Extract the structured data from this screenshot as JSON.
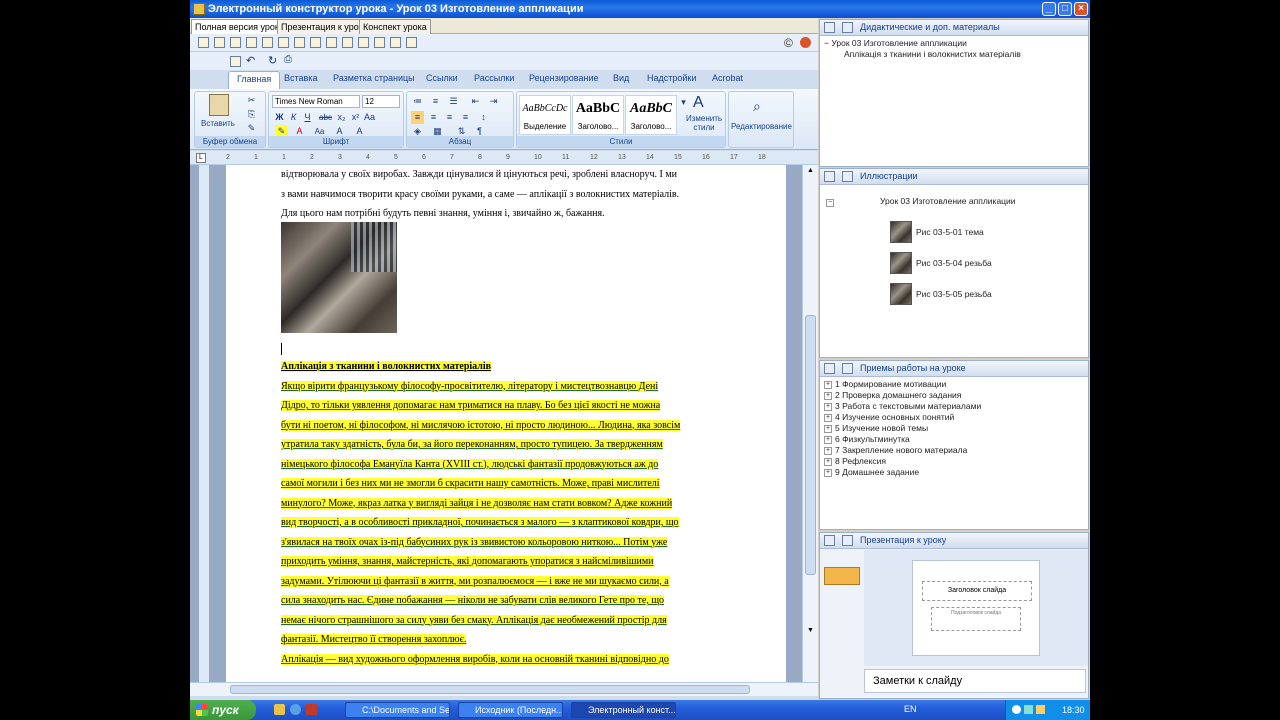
{
  "window": {
    "title": "Электронный конструктор урока - Урок 03 Изготовление аппликации",
    "controls": [
      "_",
      "□",
      "×"
    ]
  },
  "doc_tabs": [
    "Полная версия урока",
    "Презентация к уроку",
    "Конспект урока"
  ],
  "ribbon": {
    "tabs": [
      "Главная",
      "Вставка",
      "Разметка страницы",
      "Ссылки",
      "Рассылки",
      "Рецензирование",
      "Вид",
      "Надстройки",
      "Acrobat"
    ],
    "clipboard": {
      "paste_label": "Вставить",
      "group_label": "Буфер обмена"
    },
    "font": {
      "font_name": "Times New Roman",
      "font_size": "12",
      "group_label": "Шрифт"
    },
    "paragraph": {
      "group_label": "Абзац"
    },
    "styles": {
      "items": [
        {
          "preview": "AaBbCcDc",
          "name": "Выделение"
        },
        {
          "preview": "AaBbC",
          "name": "Заголово..."
        },
        {
          "preview": "AaBbC",
          "name": "Заголово..."
        }
      ],
      "change_styles": "Изменить стили",
      "group_label": "Стили"
    },
    "editing": {
      "label": "Редактирование"
    }
  },
  "ruler": {
    "ticks": [
      "2",
      "1",
      "1",
      "2",
      "3",
      "4",
      "5",
      "6",
      "7",
      "8",
      "9",
      "10",
      "11",
      "12",
      "13",
      "14",
      "15",
      "16",
      "17",
      "18"
    ]
  },
  "document": {
    "lines_top": [
      "відтворювала у своїх виробах. Завжди цінувалися й цінуються речі, зроблені власноруч. І ми",
      "з вами навчимося творити красу своїми руками, а саме — аплікації з волокнистих матеріалів.",
      "Для цього нам потрібні будуть певні знання, уміння і, звичайно ж, бажання."
    ],
    "heading": "Аплікація з тканини і волокнистих матеріалів",
    "lines_hl": [
      "Якщо вірити французькому філософу-просвітителю, літератору і мистецтвознавцю Дені",
      "Дідро, то тільки уявлення допомагає нам триматися на плаву. Бо без цієї якості не можна",
      "бути ні поетом, ні філософом, ні мислячою істотою, ні просто людиною... Людина, яка зовсім",
      "утратила таку здатність, була би, за його переконанням, просто тупицею. За твердженням",
      "німецького філософа Емануїла Канта (XVIII ст.), людські фантазії продовжуються аж до",
      "самої могили і без них ми не змогли б скрасити нашу самотність. Може, праві мислителі",
      "минулого? Може, якраз латка у вигляді зайця і не дозволяє нам стати вовком? Адже кожний",
      "вид творчості, а в особливості прикладної, починається з малого — з клаптикової ковдри, що",
      "з'явилася на твоїх очах із-під бабусиних рук із звивистою кольоровою ниткою... Потім уже",
      "приходить уміння, знання, майстерність, які допомагають упоратися з найсміливішими",
      "задумами. Утілюючи ці фантазії в життя, ми розпалюємося — і вже не ми шукаємо сили, а",
      "сила знаходить нас. Єдине побажання — ніколи не забувати слів великого Гете про те, що",
      "немає нічого страшнішого за силу уяви без смаку. Аплікація дає необмежений простір для",
      "фантазії. Мистецтво її створення захоплює.",
      "Аплікація — вид художнього оформлення виробів, коли на основній тканині відповідно до"
    ]
  },
  "panels": {
    "materials": {
      "title": "Дидактические и доп. материалы",
      "root": "Урок 03 Изготовление аппликации",
      "child": "Аплікація з тканини і волокнистих матеріалів"
    },
    "illustrations": {
      "title": "Иллюстрации",
      "root": "Урок 03 Изготовление аппликации",
      "items": [
        "Рис 03-5-01 тема",
        "Рис 03-5-04 резьба",
        "Рис 03-5-05 резьба"
      ]
    },
    "methods": {
      "title": "Приемы работы на уроке",
      "items": [
        "1 Формирование мотивации",
        "2 Проверка домашнего задания",
        "3 Работа с текстовыми материалами",
        "4 Изучение основных понятий",
        "5 Изучение новой темы",
        "6 Физкультминутка",
        "7 Закрепление нового материала",
        "8 Рефлексия",
        "9 Домашнее задание"
      ]
    },
    "presentation": {
      "title": "Презентация к уроку",
      "slide_title": "Заголовок слайда",
      "slide_subtitle": "Подзаголовок слайда",
      "notes": "Заметки к слайду"
    }
  },
  "taskbar": {
    "start": "пуск",
    "tasks": [
      "C:\\Documents and Se...",
      "Исходник (Последн...",
      "Электронный конст..."
    ],
    "lang": "EN",
    "time": "18:30"
  }
}
